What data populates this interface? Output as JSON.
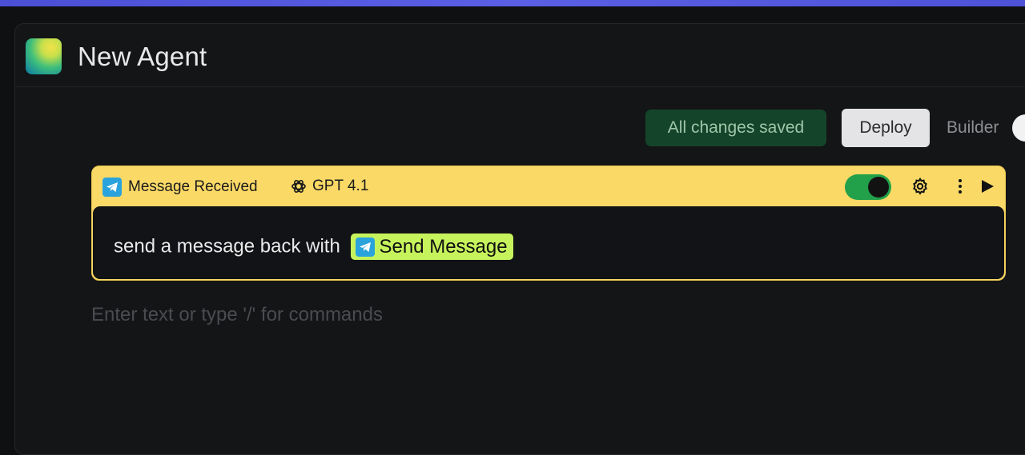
{
  "agent": {
    "title": "New Agent"
  },
  "toolbar": {
    "status_label": "All changes saved",
    "deploy_label": "Deploy",
    "builder_label": "Builder"
  },
  "block": {
    "trigger": {
      "icon": "telegram-icon",
      "label": "Message Received"
    },
    "model": {
      "icon": "openai-icon",
      "label": "GPT 4.1"
    },
    "enabled": true,
    "prompt_text": "send a message back with",
    "action_chip": {
      "icon": "telegram-icon",
      "label": "Send Message"
    }
  },
  "editor": {
    "placeholder": "Enter text or type '/' for commands"
  },
  "colors": {
    "card_header": "#fad966",
    "toggle_on": "#22a04a",
    "chip": "#c6f35c",
    "saved_bg": "#14442a",
    "accent_bar": "#5a5fe6"
  }
}
